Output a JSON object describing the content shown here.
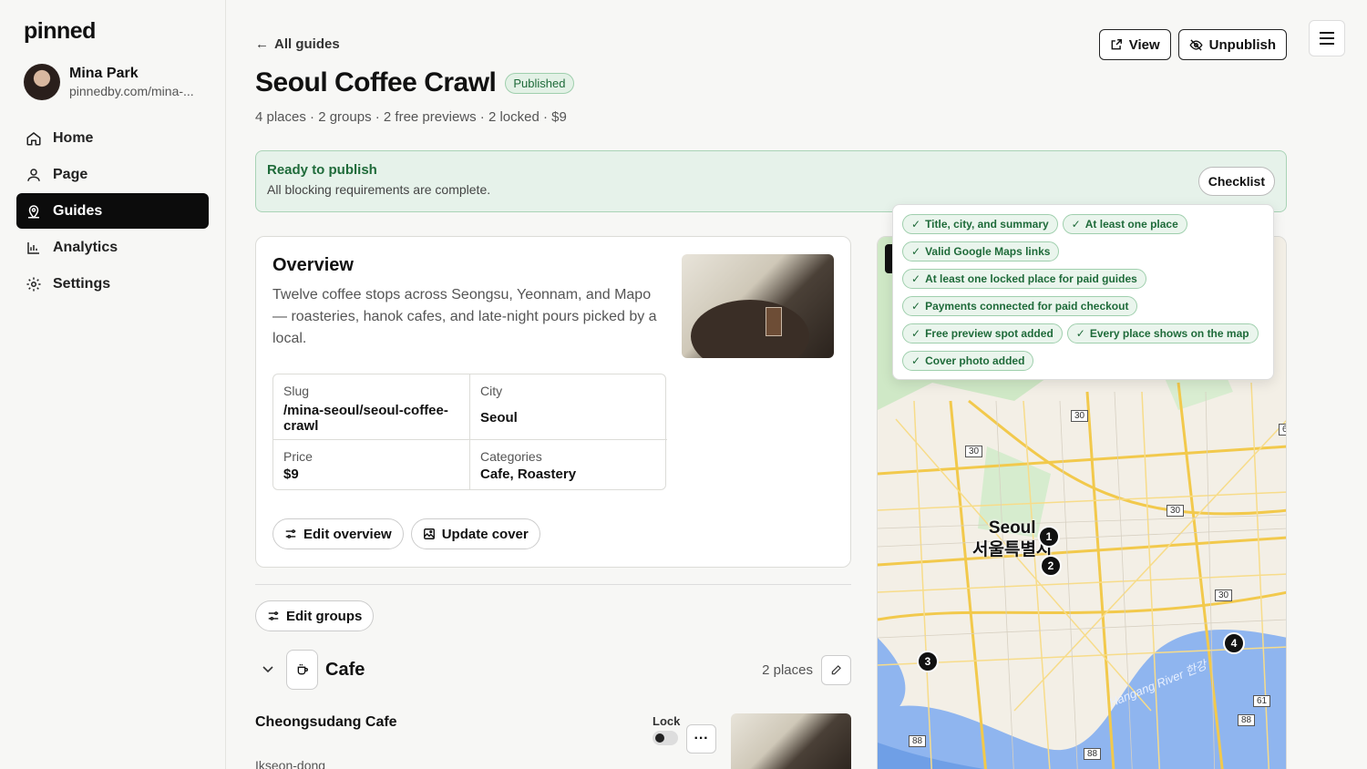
{
  "sidebar": {
    "logo": "pinned",
    "profile": {
      "name": "Mina Park",
      "url": "pinnedby.com/mina-..."
    },
    "nav": [
      {
        "label": "Home",
        "icon": "home-icon"
      },
      {
        "label": "Page",
        "icon": "user-icon"
      },
      {
        "label": "Guides",
        "icon": "map-pin-icon",
        "active": true
      },
      {
        "label": "Analytics",
        "icon": "bar-chart-icon"
      },
      {
        "label": "Settings",
        "icon": "gear-icon"
      }
    ]
  },
  "header": {
    "back_label": "All guides",
    "title": "Seoul Coffee Crawl",
    "status_badge": "Published",
    "meta": "4 places · 2 groups · 2 free previews · 2 locked · $9",
    "view_label": "View",
    "unpublish_label": "Unpublish"
  },
  "ready": {
    "title": "Ready to publish",
    "subtitle": "All blocking requirements are complete.",
    "checklist_label": "Checklist"
  },
  "checklist": {
    "items": [
      "Title, city, and summary",
      "At least one place",
      "Valid Google Maps links",
      "At least one locked place for paid guides",
      "Payments connected for paid checkout",
      "Free preview spot added",
      "Every place shows on the map",
      "Cover photo added"
    ]
  },
  "overview": {
    "title": "Overview",
    "description": "Twelve coffee stops across Seongsu, Yeonnam, and Mapo — roasteries, hanok cafes, and late-night pours picked by a local.",
    "fields": {
      "slug_label": "Slug",
      "slug_value": "/mina-seoul/seoul-coffee-crawl",
      "city_label": "City",
      "city_value": "Seoul",
      "price_label": "Price",
      "price_value": "$9",
      "categories_label": "Categories",
      "categories_value": "Cafe, Roastery"
    },
    "edit_label": "Edit overview",
    "cover_label": "Update cover"
  },
  "groups": {
    "edit_label": "Edit groups",
    "group": {
      "name": "Cafe",
      "count": "2 places"
    },
    "place": {
      "name": "Cheongsudang Cafe",
      "area": "Ikseon-dong",
      "lock_label": "Lock",
      "locked": false
    }
  },
  "map": {
    "city_en": "Seoul",
    "city_ko": "서울특별시",
    "river_label": "Hangang River 한강",
    "pins": [
      "1",
      "2",
      "3",
      "4"
    ],
    "route_shields": [
      "30",
      "30",
      "30",
      "30",
      "61",
      "88",
      "88",
      "88",
      "6"
    ]
  }
}
